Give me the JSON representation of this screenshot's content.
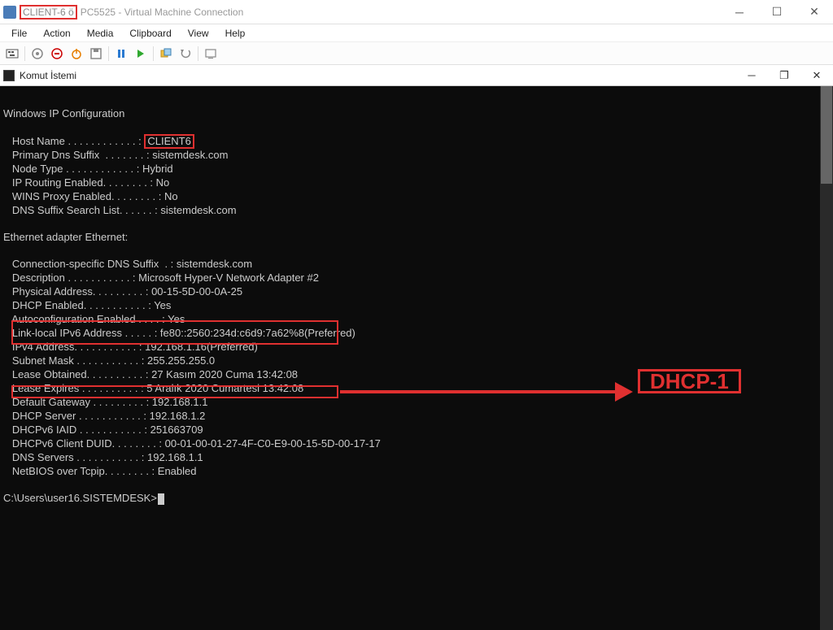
{
  "outerWindow": {
    "titleHighlighted": "CLIENT-6 ö",
    "titleRest": "PC5525 - Virtual Machine Connection",
    "menu": [
      "File",
      "Action",
      "Media",
      "Clipboard",
      "View",
      "Help"
    ]
  },
  "innerWindow": {
    "title": "Komut İstemi"
  },
  "callout": "DHCP-1",
  "ipconfig": {
    "header": "Windows IP Configuration",
    "hostLine": "   Host Name . . . . . . . . . . . . : ",
    "hostValue": "CLIENT6",
    "primaryDns": "   Primary Dns Suffix  . . . . . . . : sistemdesk.com",
    "nodeType": "   Node Type . . . . . . . . . . . . : Hybrid",
    "ipRouting": "   IP Routing Enabled. . . . . . . . : No",
    "winsProxy": "   WINS Proxy Enabled. . . . . . . . : No",
    "dnsSearch": "   DNS Suffix Search List. . . . . . : sistemdesk.com",
    "adapterHeader": "Ethernet adapter Ethernet:",
    "connSuffix": "   Connection-specific DNS Suffix  . : sistemdesk.com",
    "description": "   Description . . . . . . . . . . . : Microsoft Hyper-V Network Adapter #2",
    "physAddr": "   Physical Address. . . . . . . . . : 00-15-5D-00-0A-25",
    "dhcpEnabled": "   DHCP Enabled. . . . . . . . . . . : Yes",
    "autoconf": "   Autoconfiguration Enabled . . . . : Yes",
    "linkLocal": "   Link-local IPv6 Address . . . . . : fe80::2560:234d:c6d9:7a62%8(Preferred)",
    "ipv4": "   IPv4 Address. . . . . . . . . . . : 192.168.1.16(Preferred)",
    "subnet": "   Subnet Mask . . . . . . . . . . . : 255.255.255.0",
    "leaseObt": "   Lease Obtained. . . . . . . . . . : 27 Kasım 2020 Cuma 13:42:08",
    "leaseExp": "   Lease Expires . . . . . . . . . . : 5 Aralık 2020 Cumartesi 13:42:08",
    "gateway": "   Default Gateway . . . . . . . . . : 192.168.1.1",
    "dhcpServer": "   DHCP Server . . . . . . . . . . . : 192.168.1.2",
    "dhcpv6iaid": "   DHCPv6 IAID . . . . . . . . . . . : 251663709",
    "dhcpv6duid": "   DHCPv6 Client DUID. . . . . . . . : 00-01-00-01-27-4F-C0-E9-00-15-5D-00-17-17",
    "dnsServers": "   DNS Servers . . . . . . . . . . . : 192.168.1.1",
    "netbios": "   NetBIOS over Tcpip. . . . . . . . : Enabled",
    "prompt": "C:\\Users\\user16.SISTEMDESK>"
  }
}
